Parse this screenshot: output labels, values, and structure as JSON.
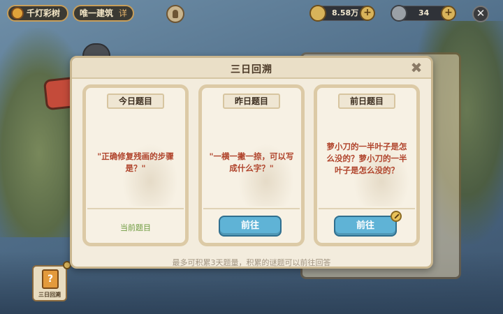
{
  "top_bar": {
    "tree_name": "千灯彩树",
    "building": "唯一建筑",
    "detail": "详",
    "coins": "8.58万",
    "tokens": "34"
  },
  "dialog": {
    "title": "三日回溯",
    "cards": [
      {
        "tag": "今日题目",
        "question": "\"正确修复残画的步骤是？\"",
        "status": "当前题目"
      },
      {
        "tag": "昨日题目",
        "question": "\"一横一撇一捺，可以写成什么字？\"",
        "button": "前往"
      },
      {
        "tag": "前日题目",
        "question": "萝小刀的一半叶子是怎么没的？萝小刀的一半叶子是怎么没的？",
        "button": "前往"
      }
    ],
    "note": "最多可积累3天题量，积累的谜题可以前往回答"
  },
  "bottom_left": {
    "book_label": "三日回溯"
  },
  "colors": {
    "accent_blue": "#5fb3d6",
    "question_red": "#b0442c",
    "current_green": "#6e9b3f"
  }
}
